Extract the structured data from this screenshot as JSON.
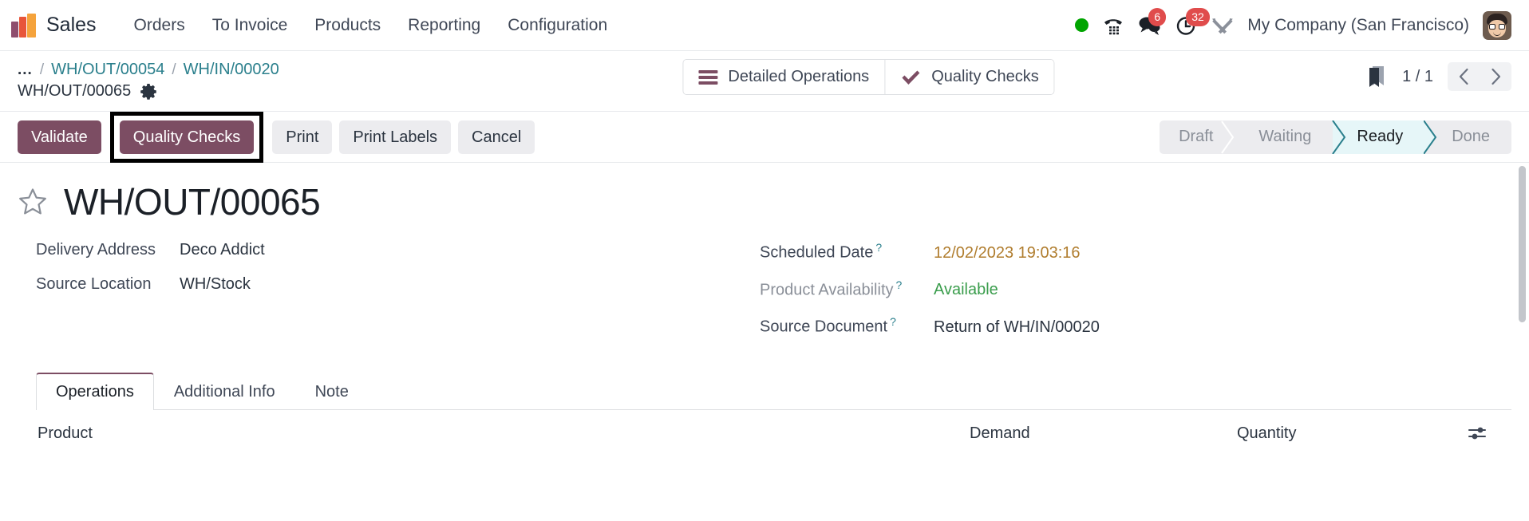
{
  "navbar": {
    "logo_icon": "sales-app-logo",
    "brand": "Sales",
    "menu": [
      {
        "label": "Orders"
      },
      {
        "label": "To Invoice"
      },
      {
        "label": "Products"
      },
      {
        "label": "Reporting"
      },
      {
        "label": "Configuration"
      }
    ],
    "status_dot_color": "#00a500",
    "phone_icon": "phone-dialpad-icon",
    "messages_icon": "messages-icon",
    "messages_count": "6",
    "activities_icon": "clock-activity-icon",
    "activities_count": "32",
    "debug_icon": "tools-debug-icon",
    "company": "My Company (San Francisco)",
    "avatar_icon": "user-avatar"
  },
  "breadcrumb": {
    "dots": "...",
    "separator": "/",
    "links": [
      {
        "label": "WH/OUT/00054"
      },
      {
        "label": "WH/IN/00020"
      }
    ],
    "current": "WH/OUT/00065",
    "settings_icon": "gear-icon"
  },
  "control_buttons": [
    {
      "label": "Detailed Operations",
      "icon": "list-lines-icon"
    },
    {
      "label": "Quality Checks",
      "icon": "check-icon"
    }
  ],
  "pager": {
    "bookmark_icon": "bookmark-icon",
    "count": "1 / 1",
    "prev_icon": "chevron-left-icon",
    "next_icon": "chevron-right-icon"
  },
  "action_buttons": [
    {
      "label": "Validate",
      "style": "primary",
      "highlighted": false
    },
    {
      "label": "Quality Checks",
      "style": "primary",
      "highlighted": true
    },
    {
      "label": "Print",
      "style": "secondary",
      "highlighted": false
    },
    {
      "label": "Print Labels",
      "style": "secondary",
      "highlighted": false
    },
    {
      "label": "Cancel",
      "style": "secondary",
      "highlighted": false
    }
  ],
  "statusbar": {
    "stages": [
      {
        "label": "Draft",
        "active": false
      },
      {
        "label": "Waiting",
        "active": false
      },
      {
        "label": "Ready",
        "active": true
      },
      {
        "label": "Done",
        "active": false
      }
    ],
    "active_color": "#2a7f8c"
  },
  "record": {
    "star_icon": "favorite-star-icon",
    "title": "WH/OUT/00065"
  },
  "fields_left": [
    {
      "label": "Delivery Address",
      "value": "Deco Addict",
      "help": false,
      "muted": false
    },
    {
      "label": "Source Location",
      "value": "WH/Stock",
      "help": false,
      "muted": false
    }
  ],
  "fields_right": [
    {
      "label": "Scheduled Date",
      "value": "12/02/2023 19:03:16",
      "help": "?",
      "muted": false,
      "value_class": "date"
    },
    {
      "label": "Product Availability",
      "value": "Available",
      "help": "?",
      "muted": true,
      "value_class": "ok"
    },
    {
      "label": "Source Document",
      "value": "Return of WH/IN/00020",
      "help": "?",
      "muted": false,
      "value_class": ""
    }
  ],
  "tabs": [
    {
      "label": "Operations",
      "active": true
    },
    {
      "label": "Additional Info",
      "active": false
    },
    {
      "label": "Note",
      "active": false
    }
  ],
  "list_header": {
    "product": "Product",
    "demand": "Demand",
    "quantity": "Quantity",
    "options_icon": "sliders-optional-columns-icon"
  },
  "colors": {
    "primary": "#7c4d63",
    "link": "#2a7f8c",
    "date": "#b07d2e",
    "success": "#3a9d4c",
    "badge": "#e04c4c"
  }
}
